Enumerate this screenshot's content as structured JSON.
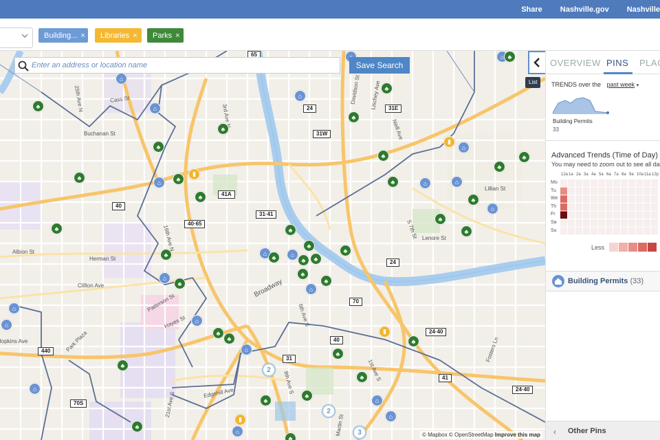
{
  "topbar": {
    "links": [
      "Share",
      "Nashville.gov",
      "Nashville"
    ]
  },
  "filters": {
    "chips": [
      {
        "label": "Building...",
        "color": "#6d9bd6"
      },
      {
        "label": "Libraries",
        "color": "#f5b833"
      },
      {
        "label": "Parks",
        "color": "#3f8a3a"
      }
    ],
    "remove_glyph": "×"
  },
  "search": {
    "placeholder": "Enter an address or location name",
    "save_label": "Save Search"
  },
  "map": {
    "attribution": {
      "mapbox": "© Mapbox",
      "osm": "© OpenStreetMap",
      "improve": "Improve this map"
    },
    "shields": [
      "65",
      "24",
      "31E",
      "31W",
      "41A",
      "31·41",
      "40",
      "40·65",
      "24",
      "70",
      "40",
      "24·40",
      "31",
      "41",
      "440",
      "24·40",
      "70S"
    ],
    "streets": [
      "Cass St",
      "Buchanan St",
      "25th Ave N",
      "3rd Ave N",
      "Lischey Ave",
      "Neill Ave",
      "Albion St",
      "Herman St",
      "16th Ave N",
      "Clifton Ave",
      "Patterson St",
      "Hayes St",
      "Park Plaza",
      "Broadway",
      "6th Ave S",
      "Lillian St",
      "S 7th St",
      "Lenore St",
      "Edgehill Ave",
      "8th Ave S",
      "21st Ave S",
      "1st Ave S",
      "Martin St",
      "Fosters Ln",
      "Davidson St",
      "Hopkins Ave"
    ],
    "clusters": [
      "2",
      "2",
      "3"
    ],
    "colors": {
      "building": "#6a93d2",
      "park": "#2e7a2e",
      "library": "#f3b52c",
      "river": "#a8cdee"
    }
  },
  "panel": {
    "list_tooltip": "List",
    "tabs": [
      "OVERVIEW",
      "PINS",
      "PLACES"
    ],
    "active_tab": "PINS",
    "trends_prefix": "TRENDS",
    "trends_over": "over the",
    "trends_period": "past week",
    "trend_label": "Building Permits",
    "trend_count": "33",
    "advanced_title": "Advanced Trends (Time of Day)",
    "advanced_sub": "You may need to zoom out to see all data",
    "hours": [
      "12a",
      "1a",
      "2a",
      "3a",
      "4a",
      "5a",
      "6a",
      "7a",
      "8a",
      "9a",
      "10a",
      "11a",
      "12p"
    ],
    "days": [
      "Mo",
      "Tu",
      "We",
      "Th",
      "Fr",
      "Sa",
      "Su"
    ],
    "legend_less": "Less",
    "legend_colors": [
      "#f6d5d0",
      "#f1b0a8",
      "#e78d85",
      "#dd6a63",
      "#c84744"
    ],
    "heat_first_col": [
      0,
      0.45,
      0.7,
      0.8,
      1.0,
      0,
      0
    ],
    "section_label": "Building Permits",
    "section_count": "(33)",
    "other_pins": "Other Pins"
  }
}
